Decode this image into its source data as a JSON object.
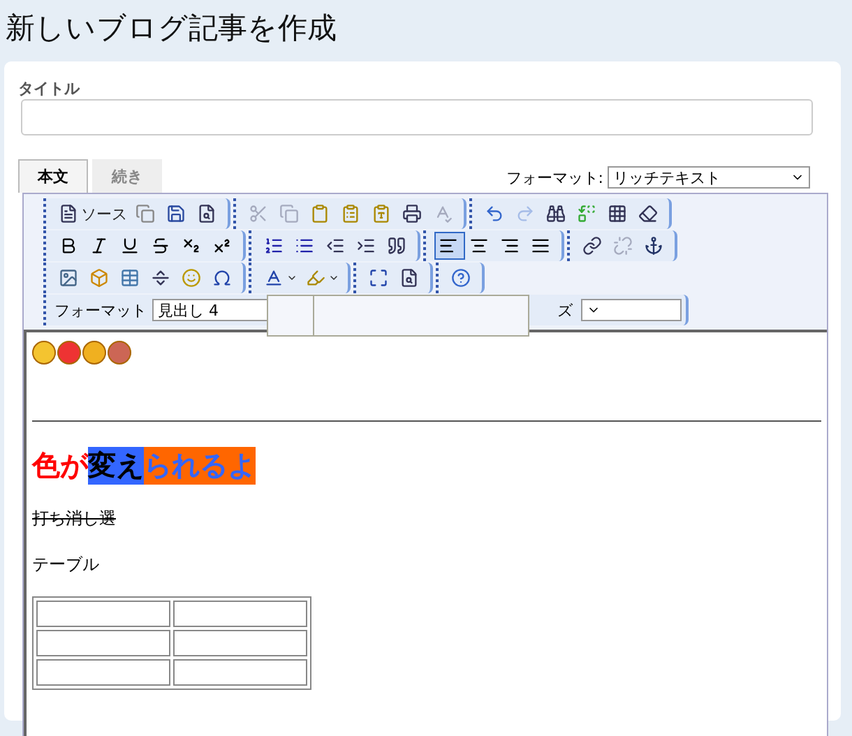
{
  "page_title": "新しいブログ記事を作成",
  "title_field": {
    "label": "タイトル"
  },
  "tabs": [
    {
      "label": "本文",
      "selected": true
    },
    {
      "label": "続き",
      "selected": false
    }
  ],
  "format_select": {
    "label": "フォーマット:",
    "value": "リッチテキスト"
  },
  "toolbar_rows": [
    [
      [
        {
          "label": "ソース",
          "disabled": false,
          "selected": false
        },
        {
          "disabled": false,
          "selected": false
        },
        {
          "disabled": false,
          "selected": false
        },
        {
          "disabled": false,
          "selected": false
        }
      ],
      [
        {
          "disabled": true,
          "selected": false
        },
        {
          "disabled": true,
          "selected": false
        },
        {
          "disabled": false,
          "selected": false
        },
        {
          "disabled": false,
          "selected": false
        },
        {
          "disabled": false,
          "selected": false
        },
        {
          "disabled": false,
          "selected": false
        },
        {
          "disabled": true,
          "selected": false
        }
      ],
      [
        {
          "disabled": false,
          "selected": false
        },
        {
          "disabled": true,
          "selected": false
        },
        {
          "disabled": false,
          "selected": false
        },
        {
          "disabled": false,
          "selected": false
        },
        {
          "disabled": false,
          "selected": false
        },
        {
          "disabled": false,
          "selected": false
        }
      ]
    ],
    [
      [
        {
          "disabled": false,
          "selected": false
        },
        {
          "disabled": false,
          "selected": false
        },
        {
          "disabled": false,
          "selected": false
        },
        {
          "disabled": false,
          "selected": false
        },
        {
          "disabled": false,
          "selected": false
        },
        {
          "disabled": false,
          "selected": false
        }
      ],
      [
        {
          "disabled": false,
          "selected": false
        },
        {
          "disabled": false,
          "selected": false
        },
        {
          "disabled": false,
          "selected": false
        },
        {
          "disabled": false,
          "selected": false
        },
        {
          "disabled": false,
          "selected": false
        }
      ],
      [
        {
          "disabled": false,
          "selected": true
        },
        {
          "disabled": false,
          "selected": false
        },
        {
          "disabled": false,
          "selected": false
        },
        {
          "disabled": false,
          "selected": false
        }
      ],
      [
        {
          "disabled": false,
          "selected": false
        },
        {
          "disabled": true,
          "selected": false
        },
        {
          "disabled": false,
          "selected": false
        }
      ]
    ],
    [
      [
        {
          "disabled": false,
          "selected": false
        },
        {
          "disabled": false,
          "selected": false
        },
        {
          "disabled": false,
          "selected": false
        },
        {
          "disabled": false,
          "selected": false
        },
        {
          "disabled": false,
          "selected": false
        },
        {
          "disabled": false,
          "selected": false
        }
      ],
      [
        {
          "disabled": false,
          "selected": false
        },
        {
          "disabled": false,
          "selected": false
        }
      ],
      [
        {
          "disabled": false,
          "selected": false
        },
        {
          "disabled": false,
          "selected": false
        }
      ],
      [
        {
          "disabled": false,
          "selected": false
        }
      ]
    ]
  ],
  "style_row": {
    "format_label": "フォーマット",
    "format_value": "見出し 4",
    "size_label": "ズ"
  },
  "content": {
    "heading": [
      {
        "text": "色が",
        "color": "#ff0000"
      },
      {
        "text": "変え",
        "color": "#000000",
        "highlight": {
          "color": "#3366ff"
        }
      },
      {
        "text": "られるよ",
        "color": "#3366ff",
        "highlight": {
          "color": "#ff6600"
        }
      }
    ],
    "strike_text": "打ち消し選",
    "table_caption": "テーブル"
  }
}
